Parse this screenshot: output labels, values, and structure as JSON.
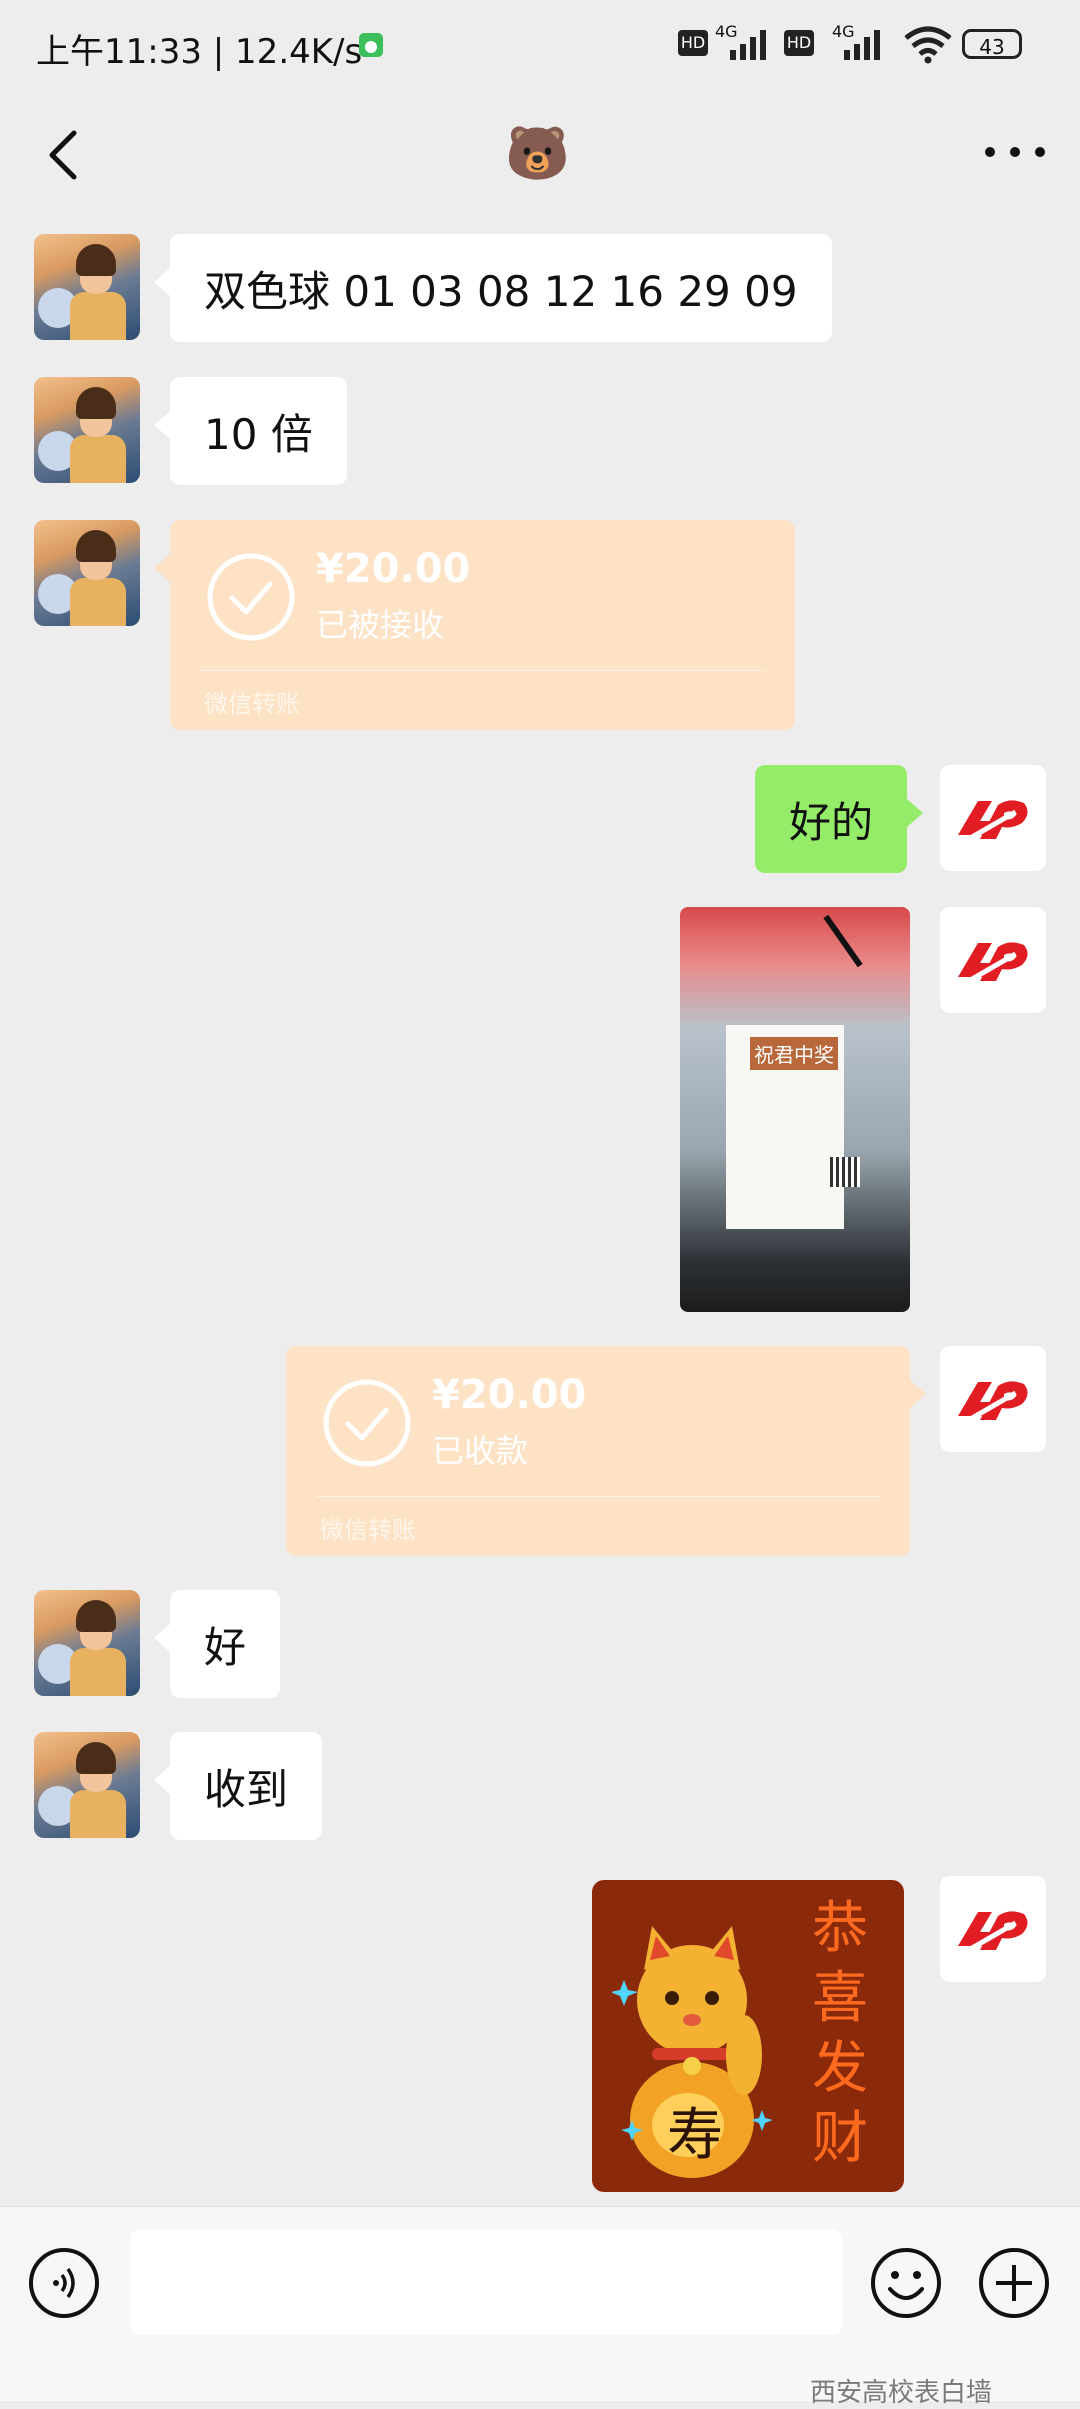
{
  "status_bar": {
    "time_text": "上午11:33 | 12.4K/s",
    "net_label_1": "4G",
    "net_label_2": "4G",
    "hd_1": "HD",
    "hd_2": "HD",
    "battery": "43"
  },
  "nav": {
    "title": "🐻"
  },
  "messages": {
    "m1": "双色球 01 03 08 12 16 29 09",
    "m2": "10 倍",
    "t1": {
      "amount": "¥20.00",
      "state": "已被接收",
      "source": "微信转账"
    },
    "m3": "好的",
    "photo_sign": "祝君中奖",
    "t2": {
      "amount": "¥20.00",
      "state": "已收款",
      "source": "微信转账"
    },
    "m4": "好",
    "m5": "收到",
    "sticker": [
      "恭",
      "喜",
      "发",
      "财"
    ],
    "sticker_fu": "寿"
  },
  "input": {
    "placeholder": ""
  },
  "watermark": "西安高校表白墙",
  "colors": {
    "green_bubble": "#95ec69",
    "transfer_bg": "#fde2c5",
    "lottery_red": "#e21c23",
    "sticker_bg": "#8b2a0b"
  },
  "icons": [
    "back-chevron-icon",
    "more-icon",
    "check-circle-icon",
    "voice-icon",
    "emoji-icon",
    "plus-icon",
    "lottery-logo-icon"
  ]
}
